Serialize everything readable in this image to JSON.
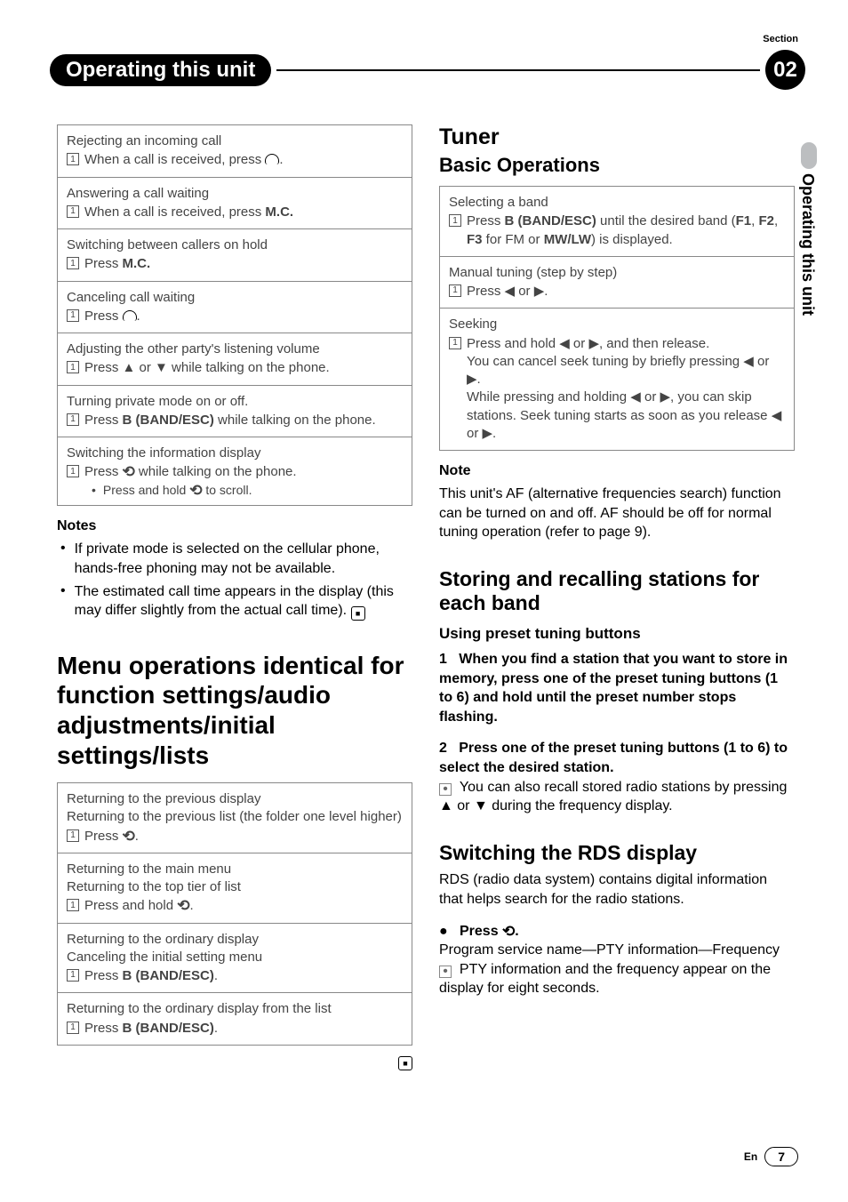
{
  "header": {
    "section_label": "Section",
    "title": "Operating this unit",
    "section_number": "02"
  },
  "side_tab": "Operating this unit",
  "left": {
    "rows": [
      {
        "title": "Rejecting an incoming call",
        "step_pre": "When a call is received, press ",
        "icon": "phone",
        "step_post": "."
      },
      {
        "title": "Answering a call waiting",
        "step_pre": "When a call is received, press ",
        "bold": "M.C."
      },
      {
        "title": "Switching between callers on hold",
        "step_pre": "Press ",
        "bold": "M.C."
      },
      {
        "title": "Canceling call waiting",
        "step_pre": "Press ",
        "icon": "phone",
        "step_post": "."
      },
      {
        "title": "Adjusting the other party's listening volume",
        "step_pre": "Press ▲ or ▼ while talking on the phone."
      },
      {
        "title": "Turning private mode on or off.",
        "step_pre": "Press ",
        "bold": "B (BAND/ESC)",
        "step_post": " while talking on the phone."
      },
      {
        "title": "Switching the information display",
        "step_pre": "Press ",
        "icon": "return",
        "step_post": " while talking on the phone.",
        "sub": "Press and hold ",
        "sub_icon": "return",
        "sub_post": " to scroll."
      }
    ],
    "notes_h": "Notes",
    "notes": [
      "If private mode is selected on the cellular phone, hands-free phoning may not be available.",
      "The estimated call time appears in the display (this may differ slightly from the actual call time)."
    ],
    "h1": "Menu operations identical for function settings/audio adjustments/initial settings/lists",
    "rows2": [
      {
        "lines": [
          "Returning to the previous display",
          "Returning to the previous list (the folder one level higher)"
        ],
        "step_pre": "Press ",
        "icon": "return",
        "step_post": "."
      },
      {
        "lines": [
          "Returning to the main menu",
          "Returning to the top tier of list"
        ],
        "step_pre": "Press and hold ",
        "icon": "return",
        "step_post": "."
      },
      {
        "lines": [
          "Returning to the ordinary display",
          "Canceling the initial setting menu"
        ],
        "step_pre": "Press ",
        "bold": "B (BAND/ESC)",
        "step_post": "."
      },
      {
        "lines": [
          "Returning to the ordinary display from the list"
        ],
        "step_pre": "Press ",
        "bold": "B (BAND/ESC)",
        "step_post": "."
      }
    ]
  },
  "right": {
    "tuner": "Tuner",
    "basic": "Basic Operations",
    "rows": [
      {
        "title": "Selecting a band",
        "body_pre": "Press ",
        "bold1": "B (BAND/ESC)",
        "mid": " until the desired band (",
        "bold2": "F1",
        "mid2": ", ",
        "bold3": "F2",
        "mid3": ", ",
        "bold4": "F3",
        "mid4": " for FM or ",
        "bold5": "MW/LW",
        "post": ") is displayed."
      },
      {
        "title": "Manual tuning (step by step)",
        "body_pre": "Press ◀ or ▶."
      },
      {
        "title": "Seeking",
        "body_pre": "Press and hold ◀ or ▶, and then release.",
        "extra": [
          "You can cancel seek tuning by briefly pressing ◀ or ▶.",
          "While pressing and holding ◀ or ▶, you can skip stations. Seek tuning starts as soon as you release ◀ or ▶."
        ]
      }
    ],
    "note_h": "Note",
    "note_body": "This unit's AF (alternative frequencies search) function can be turned on and off. AF should be off for normal tuning operation (refer to page 9).",
    "storing_h": "Storing and recalling stations for each band",
    "preset_h": "Using preset tuning buttons",
    "step1": "When you find a station that you want to store in memory, press one of the preset tuning buttons (1 to 6) and hold until the preset number stops flashing.",
    "step2": "Press one of the preset tuning buttons (1 to 6) to select the desired station.",
    "step2_sub": "You can also recall stored radio stations by pressing ▲ or ▼ during the frequency display.",
    "rds_h": "Switching the RDS display",
    "rds_p": "RDS (radio data system) contains digital information that helps search for the radio stations.",
    "press_label": "Press ",
    "press_post": ".",
    "psn": "Program service name—PTY information—Frequency",
    "pty": "PTY information and the frequency appear on the display for eight seconds."
  },
  "footer": {
    "lang": "En",
    "page": "7"
  }
}
